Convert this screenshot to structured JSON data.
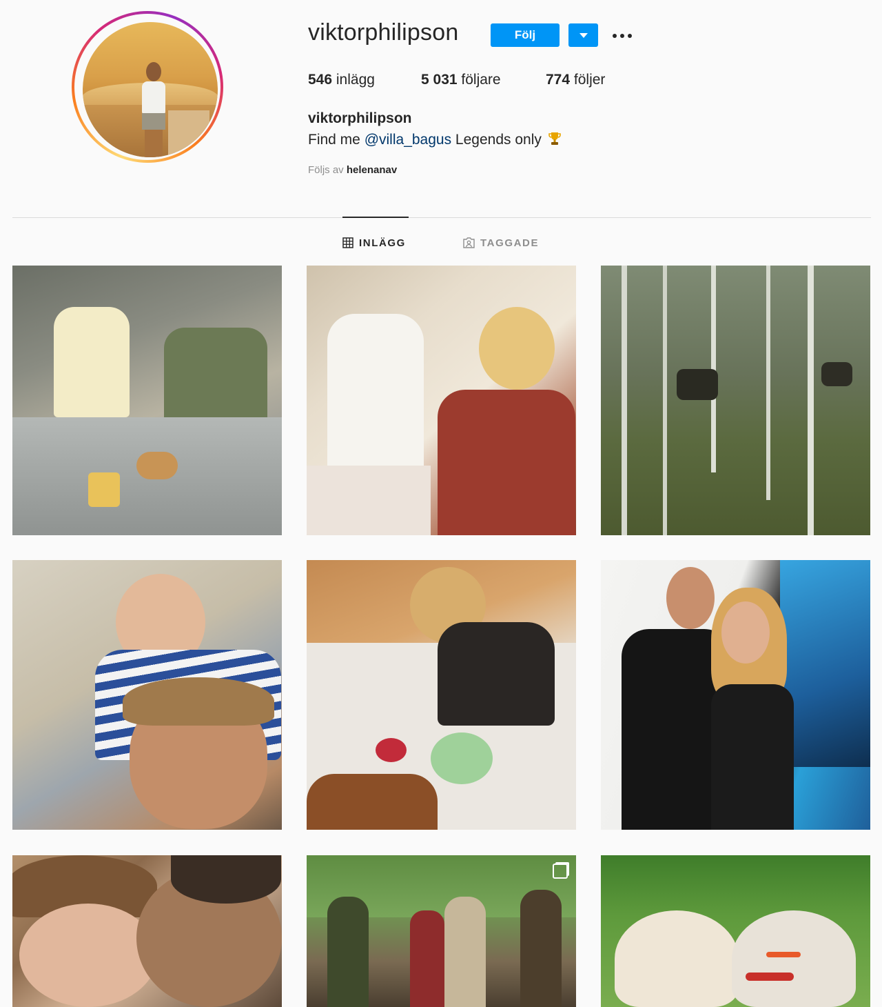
{
  "profile": {
    "username": "viktorphilipson",
    "follow_label": "Följ",
    "stats": {
      "posts_count": "546",
      "posts_label": "inlägg",
      "followers_count": "5 031",
      "followers_label": "följare",
      "following_count": "774",
      "following_label": "följer"
    },
    "full_name": "viktorphilipson",
    "bio_prefix": "Find me ",
    "bio_mention": "@villa_bagus",
    "bio_suffix": " Legends only",
    "followed_by_prefix": "Följs av",
    "followed_by_name": "helenanav"
  },
  "tabs": [
    {
      "label": "INLÄGG",
      "active": true
    },
    {
      "label": "TAGGADE",
      "active": false
    }
  ],
  "colors": {
    "follow_button": "#0095f6",
    "mention": "#00376b",
    "muted": "#8e8e8e",
    "text": "#262626"
  },
  "posts": [
    {
      "name": "post-1",
      "multi": false
    },
    {
      "name": "post-2",
      "multi": false
    },
    {
      "name": "post-3",
      "multi": false
    },
    {
      "name": "post-4",
      "multi": false
    },
    {
      "name": "post-5",
      "multi": false
    },
    {
      "name": "post-6",
      "multi": false
    },
    {
      "name": "post-7",
      "multi": false
    },
    {
      "name": "post-8",
      "multi": true
    },
    {
      "name": "post-9",
      "multi": false
    }
  ]
}
